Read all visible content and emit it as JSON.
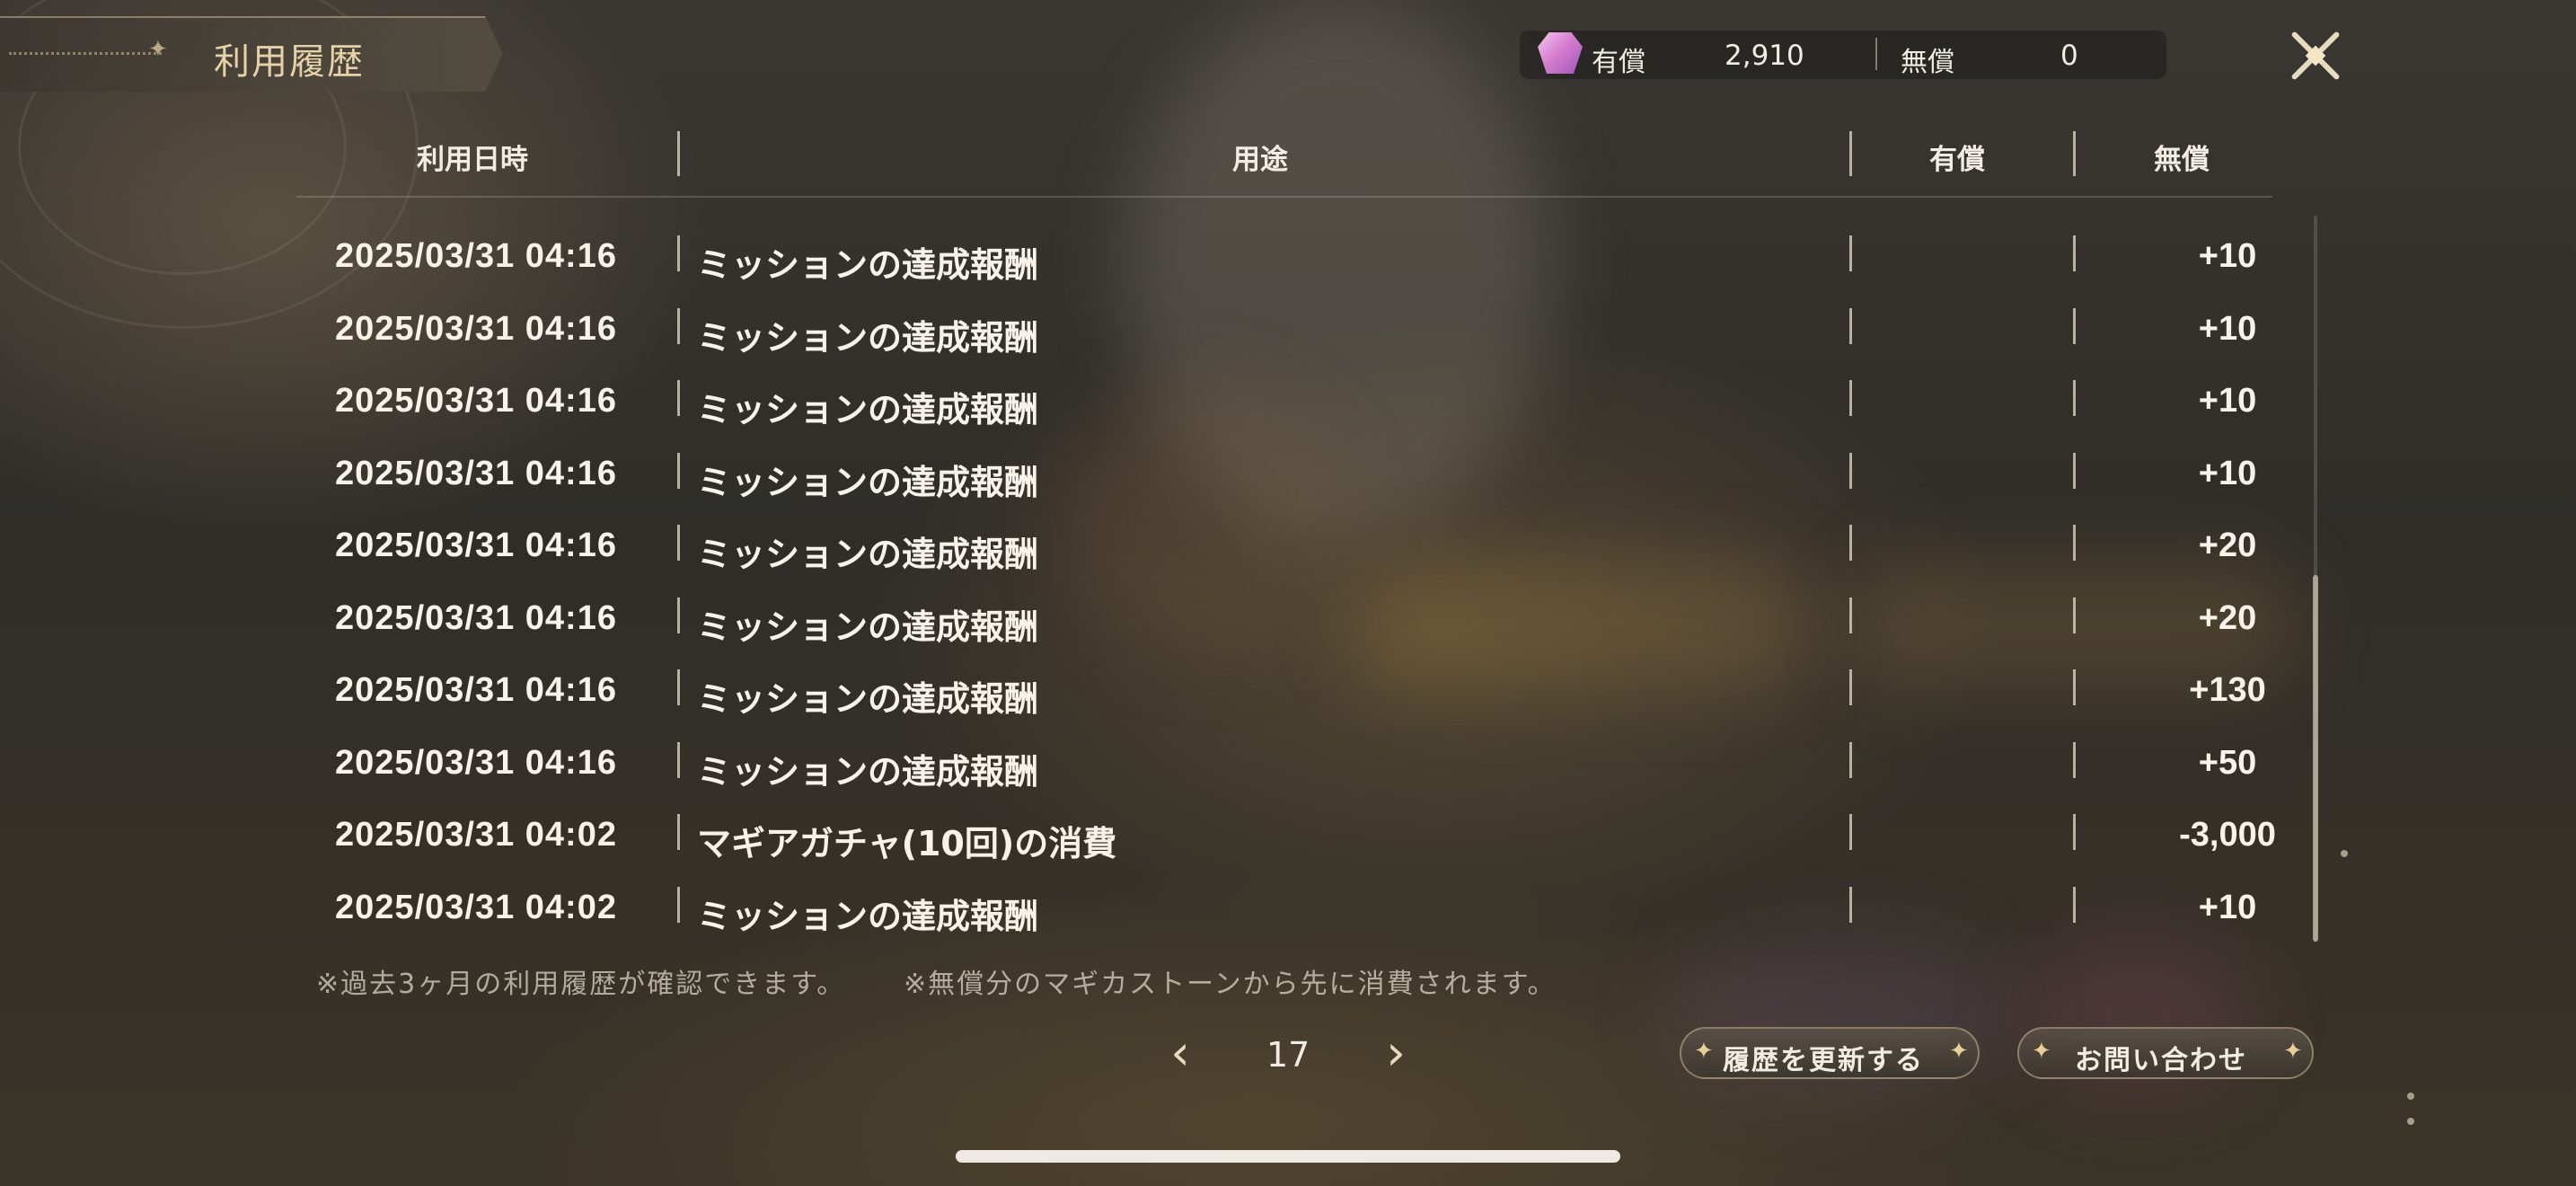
{
  "title": "利用履歴",
  "currency": {
    "paid_label": "有償",
    "paid_value": "2,910",
    "free_label": "無償",
    "free_value": "0",
    "icon": "magica-stone-gem-icon"
  },
  "table": {
    "headers": {
      "datetime": "利用日時",
      "purpose": "用途",
      "paid": "有償",
      "free": "無償"
    },
    "rows": [
      {
        "datetime": "2025/03/31 04:16",
        "purpose": "ミッションの達成報酬",
        "paid": "",
        "free": "+10"
      },
      {
        "datetime": "2025/03/31 04:16",
        "purpose": "ミッションの達成報酬",
        "paid": "",
        "free": "+10"
      },
      {
        "datetime": "2025/03/31 04:16",
        "purpose": "ミッションの達成報酬",
        "paid": "",
        "free": "+10"
      },
      {
        "datetime": "2025/03/31 04:16",
        "purpose": "ミッションの達成報酬",
        "paid": "",
        "free": "+10"
      },
      {
        "datetime": "2025/03/31 04:16",
        "purpose": "ミッションの達成報酬",
        "paid": "",
        "free": "+20"
      },
      {
        "datetime": "2025/03/31 04:16",
        "purpose": "ミッションの達成報酬",
        "paid": "",
        "free": "+20"
      },
      {
        "datetime": "2025/03/31 04:16",
        "purpose": "ミッションの達成報酬",
        "paid": "",
        "free": "+130"
      },
      {
        "datetime": "2025/03/31 04:16",
        "purpose": "ミッションの達成報酬",
        "paid": "",
        "free": "+50"
      },
      {
        "datetime": "2025/03/31 04:02",
        "purpose": "マギアガチャ(10回)の消費",
        "paid": "",
        "free": "-3,000"
      },
      {
        "datetime": "2025/03/31 04:02",
        "purpose": "ミッションの達成報酬",
        "paid": "",
        "free": "+10"
      }
    ]
  },
  "notes": {
    "note1": "※過去3ヶ月の利用履歴が確認できます。",
    "note2": "※無償分のマギカストーンから先に消費されます。"
  },
  "pagination": {
    "current_page": "17",
    "prev_icon": "chevron-left-icon",
    "next_icon": "chevron-right-icon"
  },
  "buttons": {
    "refresh": "履歴を更新する",
    "contact": "お問い合わせ"
  }
}
